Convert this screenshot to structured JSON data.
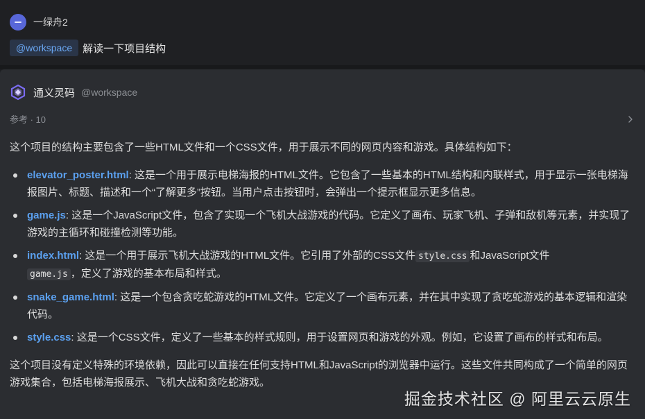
{
  "user": {
    "name": "一绿舟2",
    "mention": "@workspace",
    "query": "解读一下项目结构"
  },
  "assistant": {
    "name": "通义灵码",
    "mention": "@workspace",
    "references_label": "参考 · 10"
  },
  "answer": {
    "intro": "这个项目的结构主要包含了一些HTML文件和一个CSS文件，用于展示不同的网页内容和游戏。具体结构如下：",
    "items": [
      {
        "file": "elevator_poster.html",
        "desc": ": 这是一个用于展示电梯海报的HTML文件。它包含了一些基本的HTML结构和内联样式，用于显示一张电梯海报图片、标题、描述和一个“了解更多”按钮。当用户点击按钮时，会弹出一个提示框显示更多信息。"
      },
      {
        "file": "game.js",
        "desc": ": 这是一个JavaScript文件，包含了实现一个飞机大战游戏的代码。它定义了画布、玩家飞机、子弹和敌机等元素，并实现了游戏的主循环和碰撞检测等功能。"
      },
      {
        "file": "index.html",
        "desc_before": ": 这是一个用于展示飞机大战游戏的HTML文件。它引用了外部的CSS文件",
        "code1": "style.css",
        "desc_mid": "和JavaScript文件",
        "code2": "game.js",
        "desc_after": "，定义了游戏的基本布局和样式。"
      },
      {
        "file": "snake_game.html",
        "desc": ": 这是一个包含贪吃蛇游戏的HTML文件。它定义了一个画布元素，并在其中实现了贪吃蛇游戏的基本逻辑和渲染代码。"
      },
      {
        "file": "style.css",
        "desc": ": 这是一个CSS文件，定义了一些基本的样式规则，用于设置网页和游戏的外观。例如，它设置了画布的样式和布局。"
      }
    ],
    "outro": "这个项目没有定义特殊的环境依赖，因此可以直接在任何支持HTML和JavaScript的浏览器中运行。这些文件共同构成了一个简单的网页游戏集合，包括电梯海报展示、飞机大战和贪吃蛇游戏。"
  },
  "watermark": "掘金技术社区 @ 阿里云云原生",
  "colors": {
    "background": "#1e1f22",
    "card": "#2b2d31",
    "accent_link": "#5ba0ef",
    "mention_chip_bg": "#2a3548",
    "avatar": "#5867d9"
  },
  "icons": {
    "user_avatar": "user-avatar-icon",
    "bot_logo": "tongyi-logo-icon",
    "chevron": "chevron-right-icon"
  }
}
